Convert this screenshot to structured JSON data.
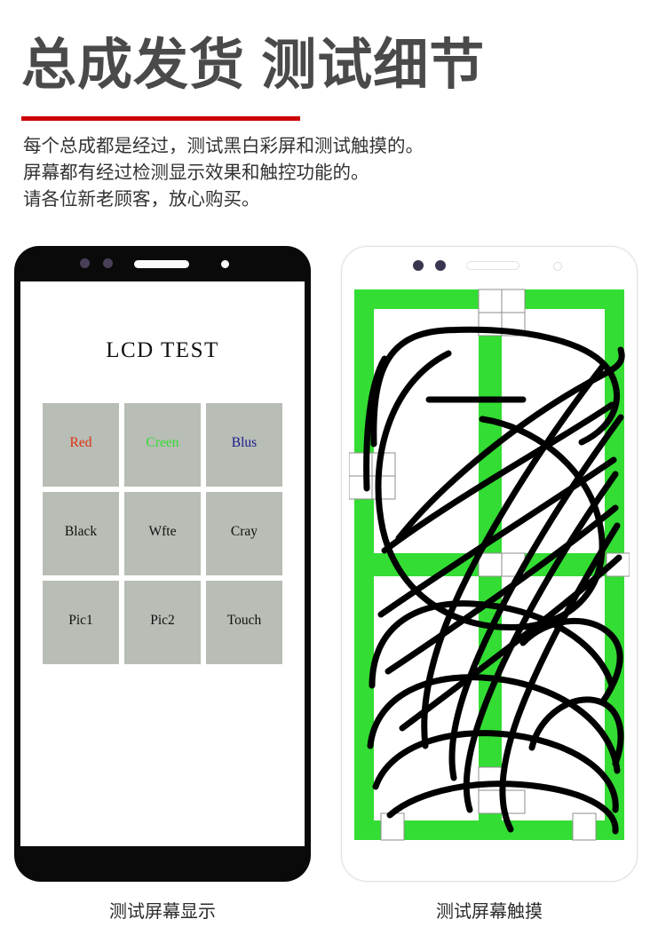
{
  "header": {
    "title": "总成发货 测试细节",
    "rule_color": "#cc0000",
    "intro_lines": [
      "每个总成都是经过，测试黑白彩屏和测试触摸的。",
      "屏幕都有经过检测显示效果和触控功能的。",
      "请各位新老顾客，放心购买。"
    ]
  },
  "phone_display": {
    "lcd_title": "LCD  TEST",
    "bezel_color": "#0a0a0a",
    "buttons": [
      {
        "label": "Red",
        "color": "#e03010"
      },
      {
        "label": "Creen",
        "color": "#33dd33"
      },
      {
        "label": "Blus",
        "color": "#1a1a8c"
      },
      {
        "label": "Black",
        "color": "#111111"
      },
      {
        "label": "Wfte",
        "color": "#111111"
      },
      {
        "label": "Cray",
        "color": "#111111"
      },
      {
        "label": "Pic1",
        "color": "#111111"
      },
      {
        "label": "Pic2",
        "color": "#111111"
      },
      {
        "label": "Touch",
        "color": "#111111"
      }
    ],
    "button_bg": "#b8bdb5",
    "caption": "测试屏幕显示"
  },
  "phone_touch": {
    "body_color": "#ffffff",
    "pattern_color": "#33dd33",
    "stroke_color": "#000000",
    "caption": "测试屏幕触摸"
  }
}
